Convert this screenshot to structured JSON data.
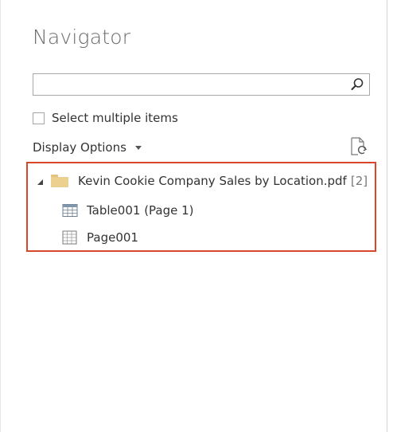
{
  "navigator": {
    "title": "Navigator",
    "search": {
      "value": "",
      "placeholder": "",
      "icon": "search-icon"
    },
    "select_multiple": {
      "label": "Select multiple items",
      "checked": false
    },
    "display_options": {
      "label": "Display Options",
      "icon": "chevron-down-icon"
    },
    "refresh_icon": "refresh-icon",
    "highlight_color": "#d9472b",
    "tree": {
      "root": {
        "label": "Kevin Cookie Company Sales by Location.pdf",
        "count": "[2]",
        "expanded": true,
        "icon": "folder-icon"
      },
      "children": [
        {
          "label": "Table001 (Page 1)",
          "icon": "table-icon"
        },
        {
          "label": "Page001",
          "icon": "page-icon"
        }
      ]
    }
  }
}
